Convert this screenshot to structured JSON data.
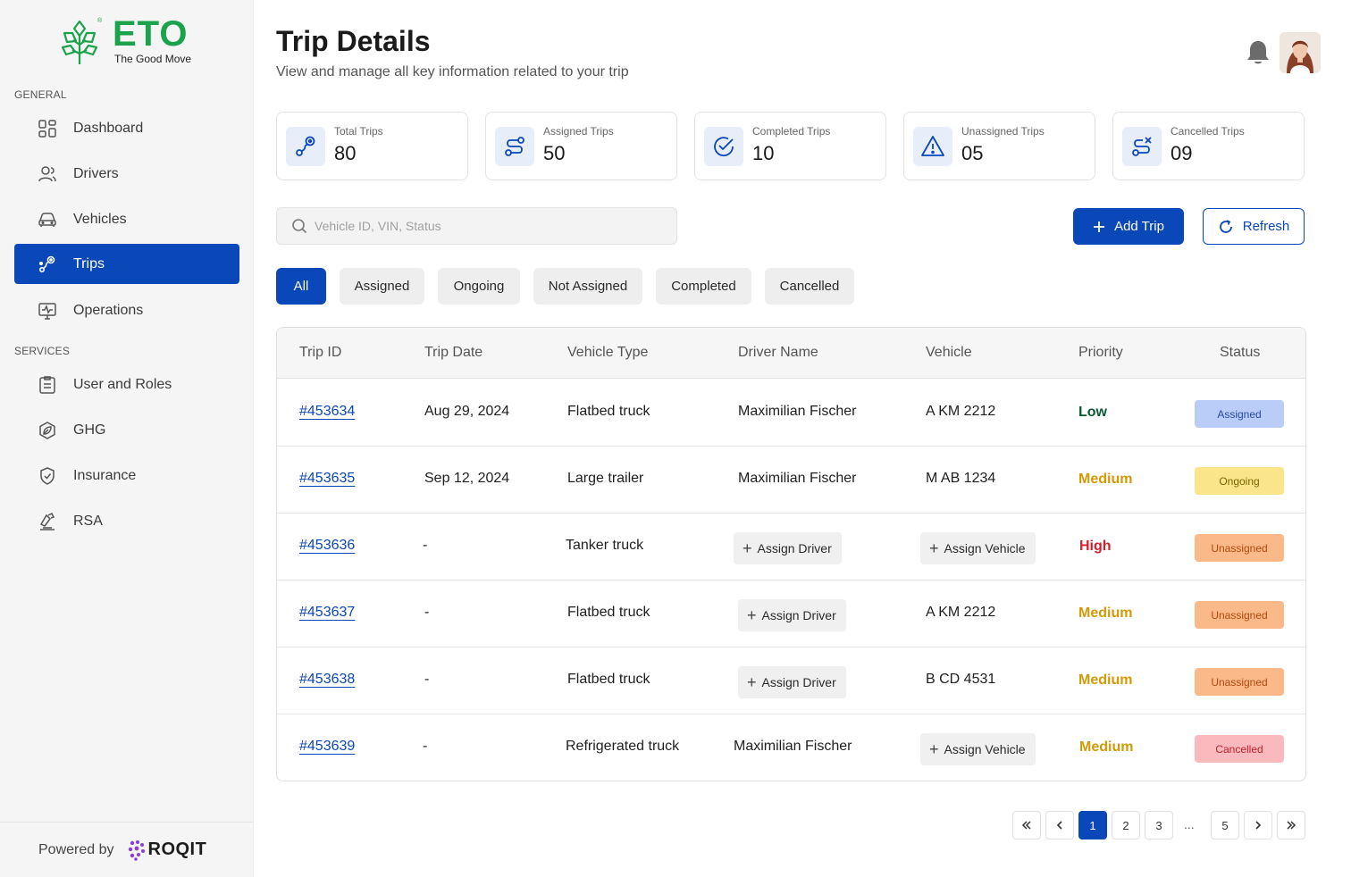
{
  "brand": {
    "name": "ETO",
    "tagline": "The Good Move",
    "registered": "®",
    "accent": "#1aa34a"
  },
  "sidebar": {
    "general_label": "GENERAL",
    "services_label": "SERVICES",
    "general_items": [
      {
        "label": "Dashboard",
        "icon": "dashboard-icon"
      },
      {
        "label": "Drivers",
        "icon": "drivers-icon"
      },
      {
        "label": "Vehicles",
        "icon": "vehicle-icon"
      },
      {
        "label": "Trips",
        "icon": "trips-icon",
        "active": true
      },
      {
        "label": "Operations",
        "icon": "operations-icon"
      }
    ],
    "service_items": [
      {
        "label": "User and Roles",
        "icon": "clipboard-icon"
      },
      {
        "label": "GHG",
        "icon": "leaf-icon"
      },
      {
        "label": "Insurance",
        "icon": "shield-icon"
      },
      {
        "label": "RSA",
        "icon": "roadside-icon"
      }
    ],
    "footer": {
      "powered_by": "Powered by",
      "partner": "ROQIT"
    }
  },
  "header": {
    "title": "Trip Details",
    "subtitle": "View and manage all key information related to your trip"
  },
  "stats": [
    {
      "label": "Total Trips",
      "value": "80",
      "icon": "route-pin-icon"
    },
    {
      "label": "Assigned Trips",
      "value": "50",
      "icon": "route-icon"
    },
    {
      "label": "Completed Trips",
      "value": "10",
      "icon": "check-circle-icon"
    },
    {
      "label": "Unassigned Trips",
      "value": "05",
      "icon": "warning-icon"
    },
    {
      "label": "Cancelled Trips",
      "value": "09",
      "icon": "route-cancel-icon"
    }
  ],
  "search": {
    "placeholder": "Vehicle ID, VIN, Status",
    "value": ""
  },
  "actions": {
    "add_trip": "Add Trip",
    "refresh": "Refresh"
  },
  "filters": [
    "All",
    "Assigned",
    "Ongoing",
    "Not Assigned",
    "Completed",
    "Cancelled"
  ],
  "active_filter": "All",
  "table": {
    "columns": [
      "Trip ID",
      "Trip Date",
      "Vehicle Type",
      "Driver Name",
      "Vehicle",
      "Priority",
      "Status"
    ],
    "rows": [
      {
        "trip_id": "#453634",
        "date": "Aug 29, 2024",
        "vehicle_type": "Flatbed truck",
        "driver": "Maximilian Fischer",
        "vehicle": "A KM 2212",
        "priority": "Low",
        "status": "Assigned"
      },
      {
        "trip_id": "#453635",
        "date": "Sep 12, 2024",
        "vehicle_type": "Large trailer",
        "driver": "Maximilian Fischer",
        "vehicle": "M AB 1234",
        "priority": "Medium",
        "status": "Ongoing"
      },
      {
        "trip_id": "#453636",
        "date": "-",
        "vehicle_type": "Tanker truck",
        "driver": null,
        "vehicle": null,
        "priority": "High",
        "status": "Unassigned"
      },
      {
        "trip_id": "#453637",
        "date": "-",
        "vehicle_type": "Flatbed truck",
        "driver": null,
        "vehicle": "A KM 2212",
        "priority": "Medium",
        "status": "Unassigned"
      },
      {
        "trip_id": "#453638",
        "date": "-",
        "vehicle_type": "Flatbed truck",
        "driver": null,
        "vehicle": "B CD 4531",
        "priority": "Medium",
        "status": "Unassigned"
      },
      {
        "trip_id": "#453639",
        "date": "-",
        "vehicle_type": "Refrigerated truck",
        "driver": "Maximilian Fischer",
        "vehicle": null,
        "priority": "Medium",
        "status": "Cancelled"
      }
    ],
    "assign_driver_label": "Assign Driver",
    "assign_vehicle_label": "Assign Vehicle"
  },
  "priority_colors": {
    "Low": "#0b5a34",
    "Medium": "#d19a06",
    "High": "#d61f2c"
  },
  "status_styles": {
    "Assigned": {
      "bg": "#b9cdf8",
      "fg": "#2a48b0"
    },
    "Ongoing": {
      "bg": "#fbe58a",
      "fg": "#7a6400"
    },
    "Unassigned": {
      "bg": "#fbb989",
      "fg": "#b14b10"
    },
    "Cancelled": {
      "bg": "#f9b9bd",
      "fg": "#c2202d"
    }
  },
  "pagination": {
    "pages": [
      "1",
      "2",
      "3",
      "...",
      "5"
    ],
    "current": "1"
  },
  "primary_color": "#0a47b8"
}
